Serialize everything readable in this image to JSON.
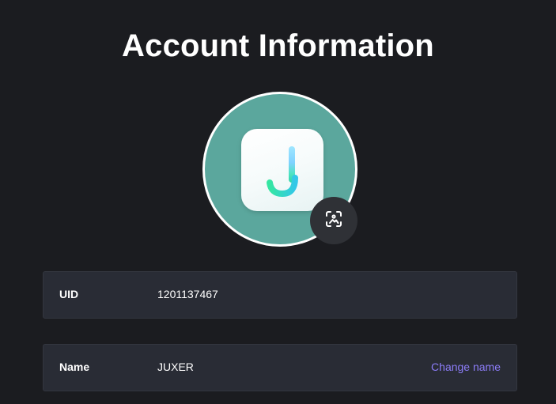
{
  "page": {
    "title": "Account Information"
  },
  "avatar": {
    "app_icon": "juxer-logo-icon",
    "background_color": "#5ba79d",
    "change_button_icon": "image-scan-icon"
  },
  "fields": {
    "uid": {
      "label": "UID",
      "value": "1201137467"
    },
    "name": {
      "label": "Name",
      "value": "JUXER",
      "action_label": "Change name"
    }
  },
  "colors": {
    "background": "#1b1c20",
    "card": "#292c35",
    "accent": "#8b7cf6"
  }
}
